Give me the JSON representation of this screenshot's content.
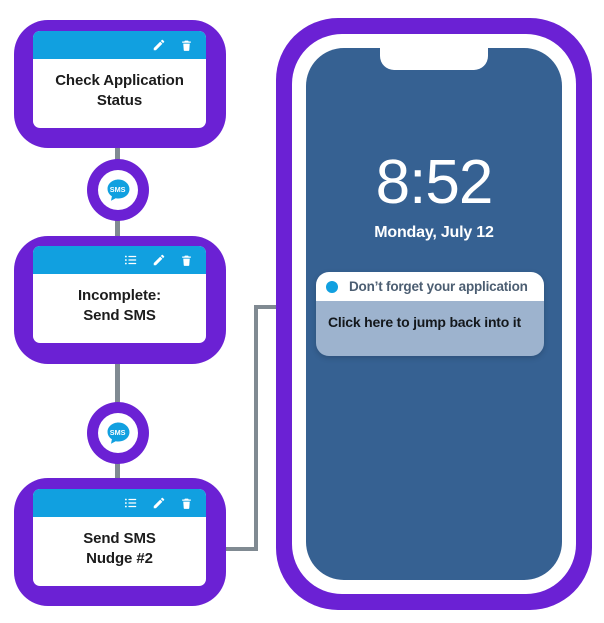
{
  "diagram": {
    "title": "SMS nudge workflow with phone lock-screen preview",
    "colors": {
      "node_frame_purple": "#6B21D4",
      "card_header_blue": "#11A0E0",
      "connector_gray": "#808A92",
      "phone_screen_blue": "#366192",
      "notification_body": "#9DB3CE",
      "card_background": "#FFFFFF"
    }
  },
  "workflow": {
    "nodes": [
      {
        "id": "check-application-status",
        "title": "Check Application\nStatus",
        "header_icons": [
          "pencil-icon",
          "trash-icon"
        ]
      },
      {
        "id": "incomplete-send-sms",
        "title": "Incomplete:\nSend SMS",
        "header_icons": [
          "list-icon",
          "pencil-icon",
          "trash-icon"
        ]
      },
      {
        "id": "send-sms-nudge-2",
        "title": "Send SMS\nNudge #2",
        "header_icons": [
          "list-icon",
          "pencil-icon",
          "trash-icon"
        ]
      }
    ],
    "connectors": [
      {
        "id": "sms-connector-1",
        "icon": "sms-bubble-icon",
        "label": "SMS"
      },
      {
        "id": "sms-connector-2",
        "icon": "sms-bubble-icon",
        "label": "SMS"
      }
    ]
  },
  "phone": {
    "lockscreen": {
      "time": "8:52",
      "date": "Monday, July 12"
    },
    "notification": {
      "app_icon": "blue-dot-icon",
      "title": "Don’t forget your application",
      "body": "Click here to jump back into it"
    }
  }
}
